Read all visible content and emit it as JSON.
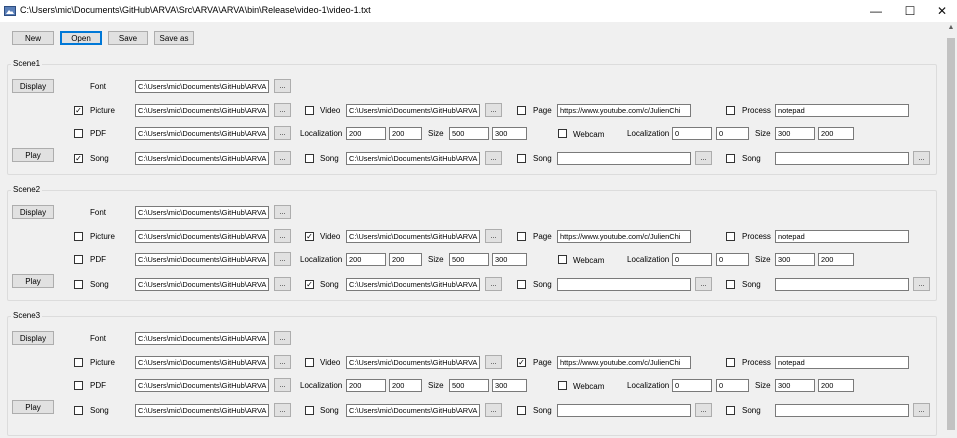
{
  "window": {
    "title": "C:\\Users\\mic\\Documents\\GitHub\\ARVA\\Src\\ARVA\\ARVA\\bin\\Release\\video-1\\video-1.txt",
    "controls": {
      "minimize": "—",
      "maximize": "☐",
      "close": "✕"
    }
  },
  "toolbar": {
    "new_label": "New",
    "open_label": "Open",
    "save_label": "Save",
    "save_as_label": "Save as"
  },
  "scenes": [
    {
      "title": "Scene1",
      "display_label": "Display",
      "play_label": "Play",
      "font_label": "Font",
      "font_path": "C:\\Users\\mic\\Documents\\GitHub\\ARVA",
      "picture": {
        "label": "Picture",
        "checked": true,
        "path": "C:\\Users\\mic\\Documents\\GitHub\\ARVA"
      },
      "pdf": {
        "label": "PDF",
        "checked": false,
        "path": "C:\\Users\\mic\\Documents\\GitHub\\ARVA"
      },
      "song1": {
        "label": "Song",
        "checked": true,
        "path": "C:\\Users\\mic\\Documents\\GitHub\\ARVA"
      },
      "video": {
        "label": "Video",
        "checked": false,
        "path": "C:\\Users\\mic\\Documents\\GitHub\\ARVA"
      },
      "video_loc": {
        "label": "Localization",
        "x": "200",
        "y": "200"
      },
      "video_size": {
        "label": "Size",
        "w": "500",
        "h": "300"
      },
      "song2": {
        "label": "Song",
        "checked": false,
        "path": "C:\\Users\\mic\\Documents\\GitHub\\ARVA"
      },
      "page": {
        "label": "Page",
        "checked": false,
        "url": "https://www.youtube.com/c/JulienChi"
      },
      "webcam": {
        "label": "Webcam",
        "checked": false
      },
      "webcam_loc": {
        "label": "Localization",
        "x": "0",
        "y": "0"
      },
      "webcam_size": {
        "label": "Size",
        "w": "300",
        "h": "200"
      },
      "song3": {
        "label": "Song",
        "checked": false,
        "path": ""
      },
      "process": {
        "label": "Process",
        "checked": false,
        "value": "notepad"
      },
      "song4": {
        "label": "Song",
        "checked": false,
        "path": ""
      }
    },
    {
      "title": "Scene2",
      "display_label": "Display",
      "play_label": "Play",
      "font_label": "Font",
      "font_path": "C:\\Users\\mic\\Documents\\GitHub\\ARVA",
      "picture": {
        "label": "Picture",
        "checked": false,
        "path": "C:\\Users\\mic\\Documents\\GitHub\\ARVA"
      },
      "pdf": {
        "label": "PDF",
        "checked": false,
        "path": "C:\\Users\\mic\\Documents\\GitHub\\ARVA"
      },
      "song1": {
        "label": "Song",
        "checked": false,
        "path": "C:\\Users\\mic\\Documents\\GitHub\\ARVA"
      },
      "video": {
        "label": "Video",
        "checked": true,
        "path": "C:\\Users\\mic\\Documents\\GitHub\\ARVA"
      },
      "video_loc": {
        "label": "Localization",
        "x": "200",
        "y": "200"
      },
      "video_size": {
        "label": "Size",
        "w": "500",
        "h": "300"
      },
      "song2": {
        "label": "Song",
        "checked": true,
        "path": "C:\\Users\\mic\\Documents\\GitHub\\ARVA"
      },
      "page": {
        "label": "Page",
        "checked": false,
        "url": "https://www.youtube.com/c/JulienChi"
      },
      "webcam": {
        "label": "Webcam",
        "checked": false
      },
      "webcam_loc": {
        "label": "Localization",
        "x": "0",
        "y": "0"
      },
      "webcam_size": {
        "label": "Size",
        "w": "300",
        "h": "200"
      },
      "song3": {
        "label": "Song",
        "checked": false,
        "path": ""
      },
      "process": {
        "label": "Process",
        "checked": false,
        "value": "notepad"
      },
      "song4": {
        "label": "Song",
        "checked": false,
        "path": ""
      }
    },
    {
      "title": "Scene3",
      "display_label": "Display",
      "play_label": "Play",
      "font_label": "Font",
      "font_path": "C:\\Users\\mic\\Documents\\GitHub\\ARVA",
      "picture": {
        "label": "Picture",
        "checked": false,
        "path": "C:\\Users\\mic\\Documents\\GitHub\\ARVA"
      },
      "pdf": {
        "label": "PDF",
        "checked": false,
        "path": "C:\\Users\\mic\\Documents\\GitHub\\ARVA"
      },
      "song1": {
        "label": "Song",
        "checked": false,
        "path": "C:\\Users\\mic\\Documents\\GitHub\\ARVA"
      },
      "video": {
        "label": "Video",
        "checked": false,
        "path": "C:\\Users\\mic\\Documents\\GitHub\\ARVA"
      },
      "video_loc": {
        "label": "Localization",
        "x": "200",
        "y": "200"
      },
      "video_size": {
        "label": "Size",
        "w": "500",
        "h": "300"
      },
      "song2": {
        "label": "Song",
        "checked": false,
        "path": "C:\\Users\\mic\\Documents\\GitHub\\ARVA"
      },
      "page": {
        "label": "Page",
        "checked": true,
        "url": "https://www.youtube.com/c/JulienChi"
      },
      "webcam": {
        "label": "Webcam",
        "checked": false
      },
      "webcam_loc": {
        "label": "Localization",
        "x": "0",
        "y": "0"
      },
      "webcam_size": {
        "label": "Size",
        "w": "300",
        "h": "200"
      },
      "song3": {
        "label": "Song",
        "checked": false,
        "path": ""
      },
      "process": {
        "label": "Process",
        "checked": false,
        "value": "notepad"
      },
      "song4": {
        "label": "Song",
        "checked": false,
        "path": ""
      }
    }
  ],
  "browse_label": "...",
  "colors": {
    "focus": "#0078d7",
    "window_bg": "#f0f0f0"
  },
  "icons": {
    "app": "app-icon",
    "scroll": "vertical-scrollbar"
  }
}
